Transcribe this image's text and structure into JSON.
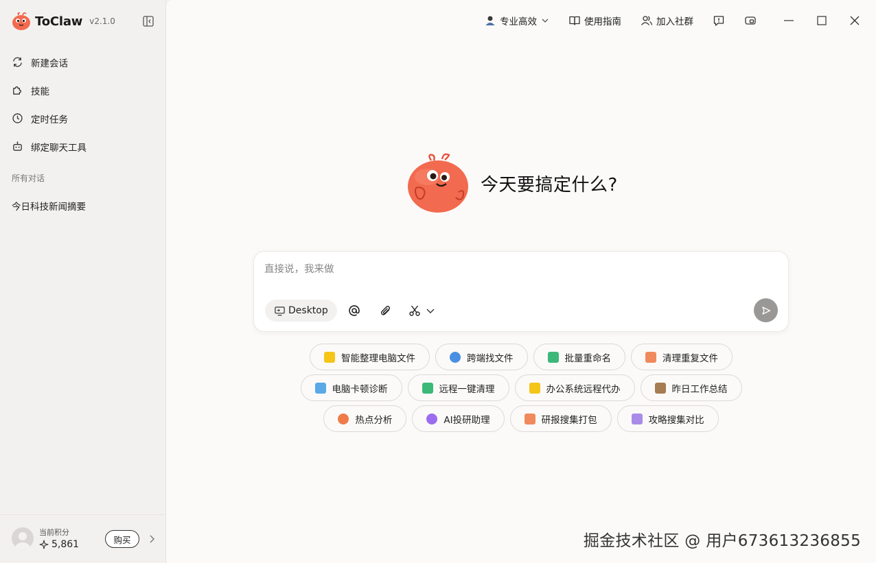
{
  "app": {
    "name": "ToClaw",
    "version": "v2.1.0"
  },
  "sidebar": {
    "nav": [
      {
        "label": "新建会话",
        "icon": "new-chat-icon"
      },
      {
        "label": "技能",
        "icon": "puzzle-icon"
      },
      {
        "label": "定时任务",
        "icon": "clock-icon"
      },
      {
        "label": "绑定聊天工具",
        "icon": "bot-icon"
      }
    ],
    "section_title": "所有对话",
    "conversations": [
      "今日科技新闻摘要"
    ],
    "footer": {
      "points_label": "当前积分",
      "points_value": "5,861",
      "buy_label": "购买"
    }
  },
  "topbar": {
    "mode_label": "专业高效",
    "guide_label": "使用指南",
    "community_label": "加入社群"
  },
  "hero": {
    "title": "今天要搞定什么?"
  },
  "composer": {
    "placeholder": "直接说，我来做",
    "desktop_label": "Desktop"
  },
  "suggestions": [
    [
      {
        "label": "智能整理电脑文件",
        "icon": "folder-icon",
        "color": "#f5c518"
      },
      {
        "label": "跨端找文件",
        "icon": "search-icon",
        "color": "#4a90e2"
      },
      {
        "label": "批量重命名",
        "icon": "t-icon",
        "color": "#3cb878"
      },
      {
        "label": "清理重复文件",
        "icon": "clean-icon",
        "color": "#f08a5d"
      }
    ],
    [
      {
        "label": "电脑卡顿诊断",
        "icon": "monitor-icon",
        "color": "#5aa9e6"
      },
      {
        "label": "远程一键清理",
        "icon": "broom-icon",
        "color": "#3cb878"
      },
      {
        "label": "办公系统远程代办",
        "icon": "oa-icon",
        "color": "#f5c518"
      },
      {
        "label": "昨日工作总结",
        "icon": "summary-icon",
        "color": "#a67c52"
      }
    ],
    [
      {
        "label": "热点分析",
        "icon": "fire-icon",
        "color": "#f07b4a"
      },
      {
        "label": "AI投研助理",
        "icon": "ai-icon",
        "color": "#9b6cf0"
      },
      {
        "label": "研报搜集打包",
        "icon": "package-icon",
        "color": "#f08a5d"
      },
      {
        "label": "攻略搜集对比",
        "icon": "compare-icon",
        "color": "#a98be8"
      }
    ]
  ],
  "watermark": "掘金技术社区 @ 用户673613236855"
}
